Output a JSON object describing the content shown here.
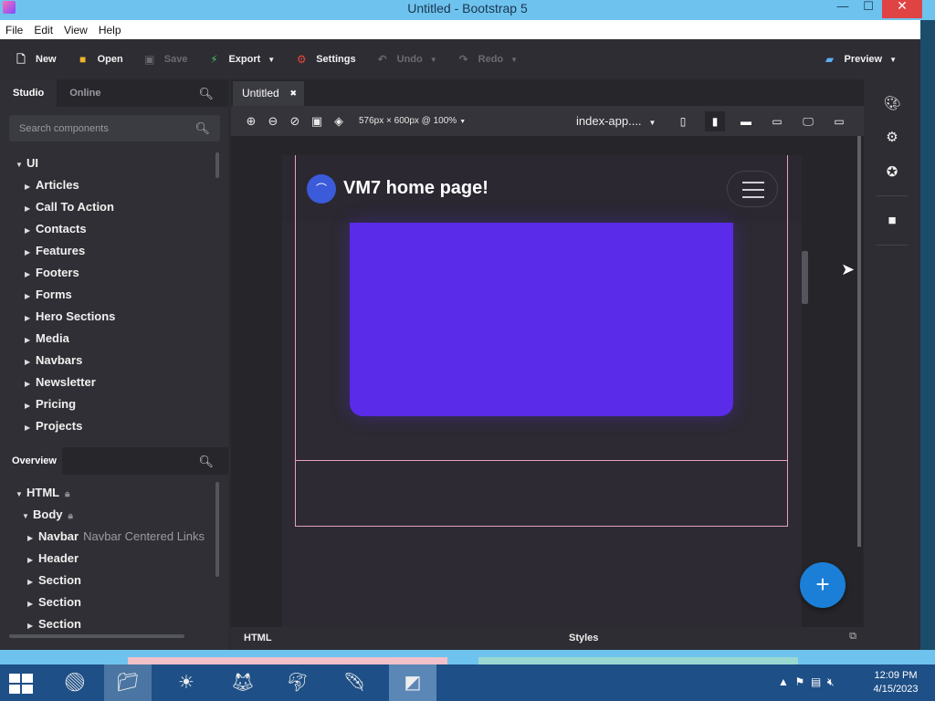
{
  "window": {
    "title": "Untitled - Bootstrap 5",
    "minimize": "—",
    "maximize": "☐",
    "close": "✕"
  },
  "menu": [
    "File",
    "Edit",
    "View",
    "Help"
  ],
  "toolbar": {
    "new": "New",
    "open": "Open",
    "save": "Save",
    "export": "Export",
    "settings": "Settings",
    "undo": "Undo",
    "redo": "Redo",
    "preview": "Preview"
  },
  "left": {
    "tabs": [
      "Studio",
      "Online"
    ],
    "search_placeholder": "Search components",
    "tree_root": "UI",
    "components": [
      "Articles",
      "Call To Action",
      "Contacts",
      "Features",
      "Footers",
      "Forms",
      "Hero Sections",
      "Media",
      "Navbars",
      "Newsletter",
      "Pricing",
      "Projects"
    ]
  },
  "overview": {
    "title": "Overview",
    "html": "HTML",
    "body": "Body",
    "navbar": "Navbar",
    "navbar_sub": "Navbar Centered Links",
    "header": "Header",
    "sections": [
      "Section",
      "Section",
      "Section"
    ]
  },
  "editor": {
    "tab": "Untitled",
    "size": "576px × 600px @ 100%",
    "file": "index-app....",
    "brand": "VM7 home page!",
    "bottom_html": "HTML",
    "bottom_styles": "Styles"
  },
  "taskbar": {
    "time": "12:09 PM",
    "date": "4/15/2023"
  },
  "colors": {
    "accent": "#5a2be8",
    "fab": "#1b7fd7",
    "titlebar": "#6ec3ee",
    "taskbar": "#1e4f86"
  }
}
